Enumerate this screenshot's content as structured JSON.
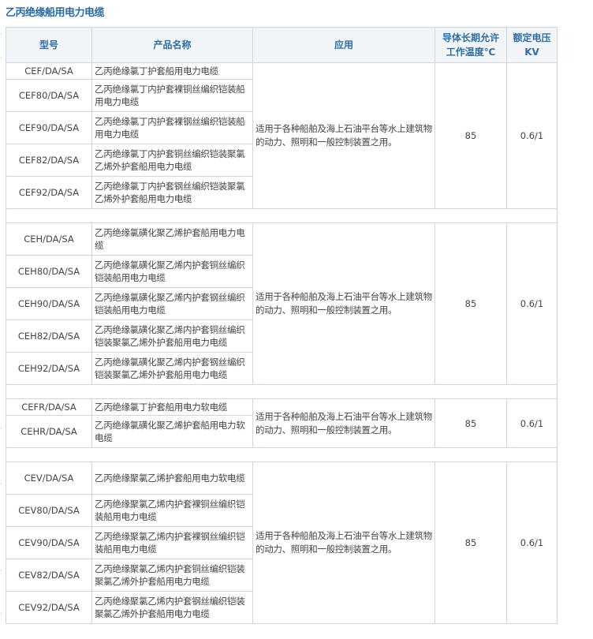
{
  "page": {
    "title": "乙丙绝缘船用电力电缆"
  },
  "table": {
    "headers": [
      "型号",
      "产品名称",
      "应用",
      "导体长期允许工作温度℃",
      "额定电压KV"
    ],
    "header_lines": {
      "temp": [
        "导体长期允许",
        "工作温度℃"
      ],
      "voltage": [
        "额定电压",
        "KV"
      ]
    },
    "groups": [
      {
        "application": "适用于各种船舶及海上石油平台等水上建筑物的动力、照明和一般控制装置之用。",
        "temperature": "85",
        "voltage": "0.6/1",
        "rows": [
          {
            "model": "CEF/DA/SA",
            "name": "乙丙绝缘氯丁护套船用电力电缆"
          },
          {
            "model": "CEF80/DA/SA",
            "name": "乙丙绝缘氯丁内护套裸铜丝编织铠装船用电力电缆"
          },
          {
            "model": "CEF90/DA/SA",
            "name": "乙丙绝缘氯丁内护套裸钢丝编织铠装船用电力电缆"
          },
          {
            "model": "CEF82/DA/SA",
            "name": "乙丙绝缘氯丁内护套铜丝编织铠装聚氯乙烯外护套船用电力电缆"
          },
          {
            "model": "CEF92/DA/SA",
            "name": "乙丙绝缘氯丁内护套钢丝编织铠装聚氯乙烯外护套船用电力电缆"
          }
        ]
      },
      {
        "application": "适用于各种船舶及海上石油平台等水上建筑物的动力、照明和一般控制装置之用。",
        "temperature": "85",
        "voltage": "0.6/1",
        "rows": [
          {
            "model": "CEH/DA/SA",
            "name": "乙丙绝缘氯磺化聚乙烯护套船用电力电缆"
          },
          {
            "model": "CEH80/DA/SA",
            "name": "乙丙绝缘氯磺化聚乙烯内护套铜丝编织铠装船用电力电缆"
          },
          {
            "model": "CEH90/DA/SA",
            "name": "乙丙绝缘氯磺化聚乙烯内护套钢丝编织铠装船用电力电缆"
          },
          {
            "model": "CEH82/DA/SA",
            "name": "乙丙绝缘氯磺化聚乙烯内护套铜丝编织铠装聚氯乙烯外护套船用电力电缆"
          },
          {
            "model": "CEH92/DA/SA",
            "name": "乙丙绝缘氯磺化聚乙烯内护套钢丝编织铠装聚氯乙烯外护套船用电力电缆"
          }
        ]
      },
      {
        "application": "适用于各种船舶及海上石油平台等水上建筑物的动力、照明和一般控制装置之用。",
        "temperature": "85",
        "voltage": "0.6/1",
        "rows": [
          {
            "model": "CEFR/DA/SA",
            "name": "乙丙绝缘氯丁护套船用电力软电缆"
          },
          {
            "model": "CEHR/DA/SA",
            "name": "乙丙绝缘氯磺化聚乙烯护套船用电力软电缆"
          }
        ]
      },
      {
        "application": "适用于各种船舶及海上石油平台等水上建筑物的动力、照明和一般控制装置之用。",
        "temperature": "85",
        "voltage": "0.6/1",
        "rows": [
          {
            "model": "CEV/DA/SA",
            "name": "乙丙绝缘聚氯乙烯护套船用电力软电缆"
          },
          {
            "model": "CEV80/DA/SA",
            "name": "乙丙绝缘聚氯乙烯内护套裸铜丝编织铠装船用电力电缆"
          },
          {
            "model": "CEV90/DA/SA",
            "name": "乙丙绝缘聚氯乙烯内护套裸钢丝编织铠装船用电力电缆"
          },
          {
            "model": "CEV82/DA/SA",
            "name": "乙丙绝缘聚氯乙烯内护套铜丝编织铠装聚氯乙烯外护套船用电力电缆"
          },
          {
            "model": "CEV92/DA/SA",
            "name": "乙丙绝缘聚氯乙烯内护套钢丝编织铠装聚氯乙烯外护套船用电力电缆"
          }
        ]
      }
    ]
  }
}
